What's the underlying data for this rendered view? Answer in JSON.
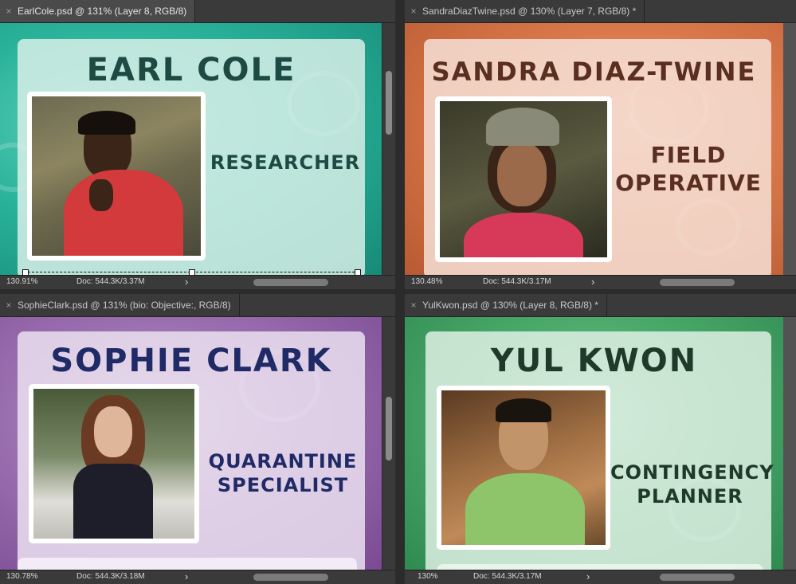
{
  "panes": [
    {
      "tab_title": "EarlCole.psd @ 131% (Layer 8, RGB/8)",
      "name": "EARL COLE",
      "role_lines": [
        "RESEARCHER"
      ],
      "zoom": "130.91%",
      "doc": "Doc: 544.3K/3.37M",
      "colors": {
        "bg": "#2ab39a",
        "bg_dark": "#168a78",
        "card": "rgba(215,238,232,0.85)",
        "text": "#1d4b44"
      },
      "photo_icon": "man-in-red-shirt-photo"
    },
    {
      "tab_title": "SandraDiazTwine.psd @ 130% (Layer 7, RGB/8) *",
      "name": "SANDRA DIAZ-TWINE",
      "role_lines": [
        "FIELD",
        "OPERATIVE"
      ],
      "zoom": "130.48%",
      "doc": "Doc: 544.3K/3.17M",
      "colors": {
        "bg": "#d9784a",
        "bg_dark": "#b85a32",
        "card": "rgba(246,225,214,0.85)",
        "text": "#5a2f22"
      },
      "photo_icon": "woman-in-camo-hat-photo"
    },
    {
      "tab_title": "SophieClark.psd @ 131% (bio:  Objective:, RGB/8)",
      "name": "SOPHIE CLARK",
      "role_lines": [
        "QUARANTINE",
        "SPECIALIST"
      ],
      "zoom": "130.78%",
      "doc": "Doc: 544.3K/3.18M",
      "colors": {
        "bg": "#9a6fb0",
        "bg_dark": "#7a4a92",
        "card": "rgba(235,225,240,0.85)",
        "text": "#1f2a66"
      },
      "photo_icon": "woman-in-black-top-photo"
    },
    {
      "tab_title": "YulKwon.psd @ 130% (Layer 8, RGB/8) *",
      "name": "YUL KWON",
      "role_lines": [
        "CONTINGENCY",
        "PLANNER"
      ],
      "zoom": "130%",
      "doc": "Doc: 544.3K/3.17M",
      "colors": {
        "bg": "#4caa6c",
        "bg_dark": "#2f8a4f",
        "card": "rgba(222,240,228,0.85)",
        "text": "#1f3a28"
      },
      "photo_icon": "man-in-green-shirt-photo"
    }
  ],
  "icons": {
    "close": "×",
    "status_arrow": "›"
  }
}
